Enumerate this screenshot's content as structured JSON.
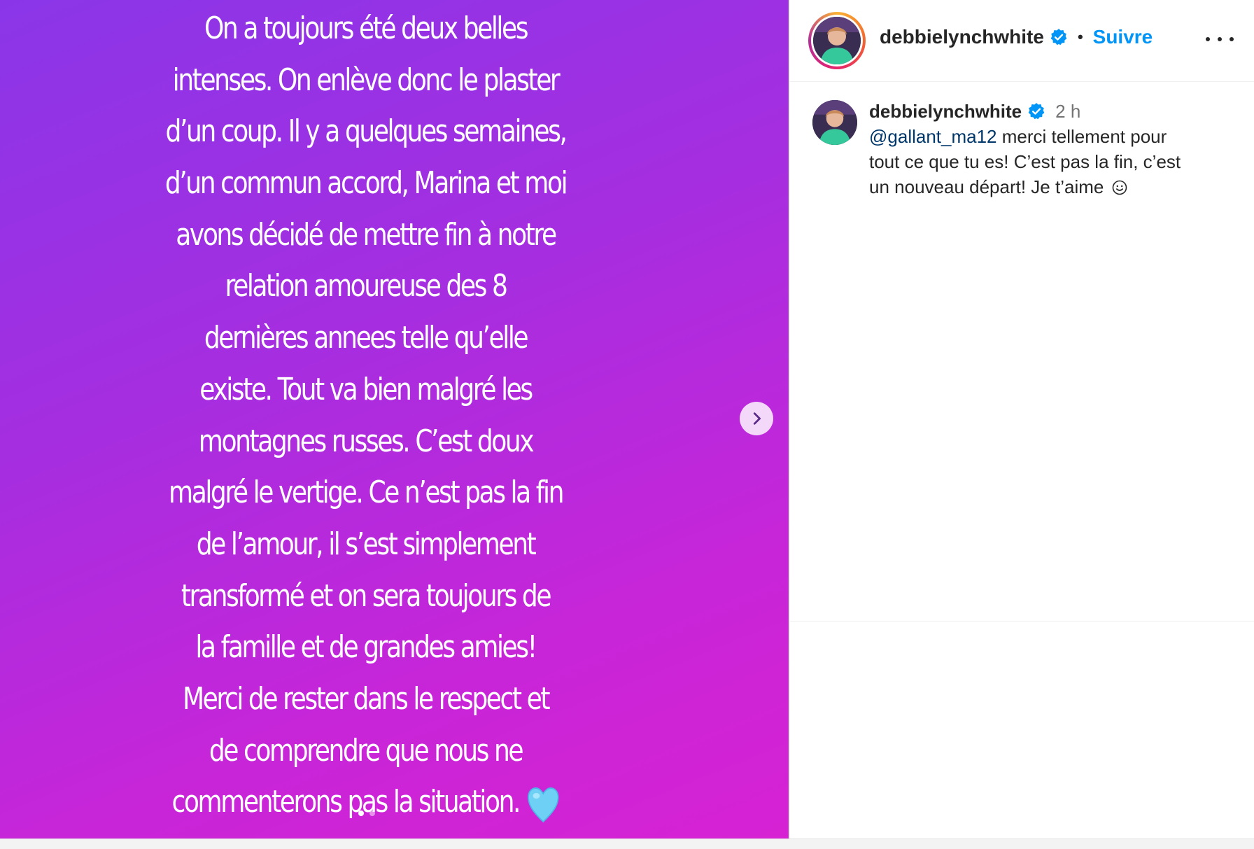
{
  "story": {
    "lines": [
      "On a toujours été deux belles",
      "intenses. On enlève donc le plaster",
      "d’un coup. Il y a quelques semaines,",
      "d’un commun accord, Marina et moi",
      "avons décidé de mettre fin à notre",
      "relation amoureuse des 8",
      "dernières annees telle qu’elle",
      "existe. Tout va bien malgré les",
      "montagnes russes. C’est doux",
      "malgré le vertige. Ce n’est pas la fin",
      "de l’amour, il s’est simplement",
      "transformé et on sera toujours de",
      "la famille et de grandes amies!",
      "Merci de rester dans le respect et",
      "de comprendre que nous ne",
      "commenterons pas la situation."
    ],
    "heart_icon": "light-blue-heart-emoji",
    "next_icon": "chevron-right-icon",
    "carousel_dots": 2,
    "active_dot": 0
  },
  "header": {
    "username": "debbielynchwhite",
    "separator": "•",
    "follow_label": "Suivre",
    "verified_icon": "verified-badge-icon",
    "more_icon": "more-options-icon"
  },
  "caption": {
    "username": "debbielynchwhite",
    "time": "2 h",
    "mention": "@gallant_ma12",
    "text_line1": " merci tellement pour",
    "text_line2": "tout ce que tu es! C’est pas la fin, c’est",
    "text_line3": "un nouveau départ! Je t’aime",
    "emoji": "smiling-face-emoji"
  },
  "colors": {
    "gradient_start": "#8a36e8",
    "gradient_end": "#d622d3",
    "follow_blue": "#0095f6",
    "mention_blue": "#00376b",
    "verified_blue": "#0095f6"
  }
}
